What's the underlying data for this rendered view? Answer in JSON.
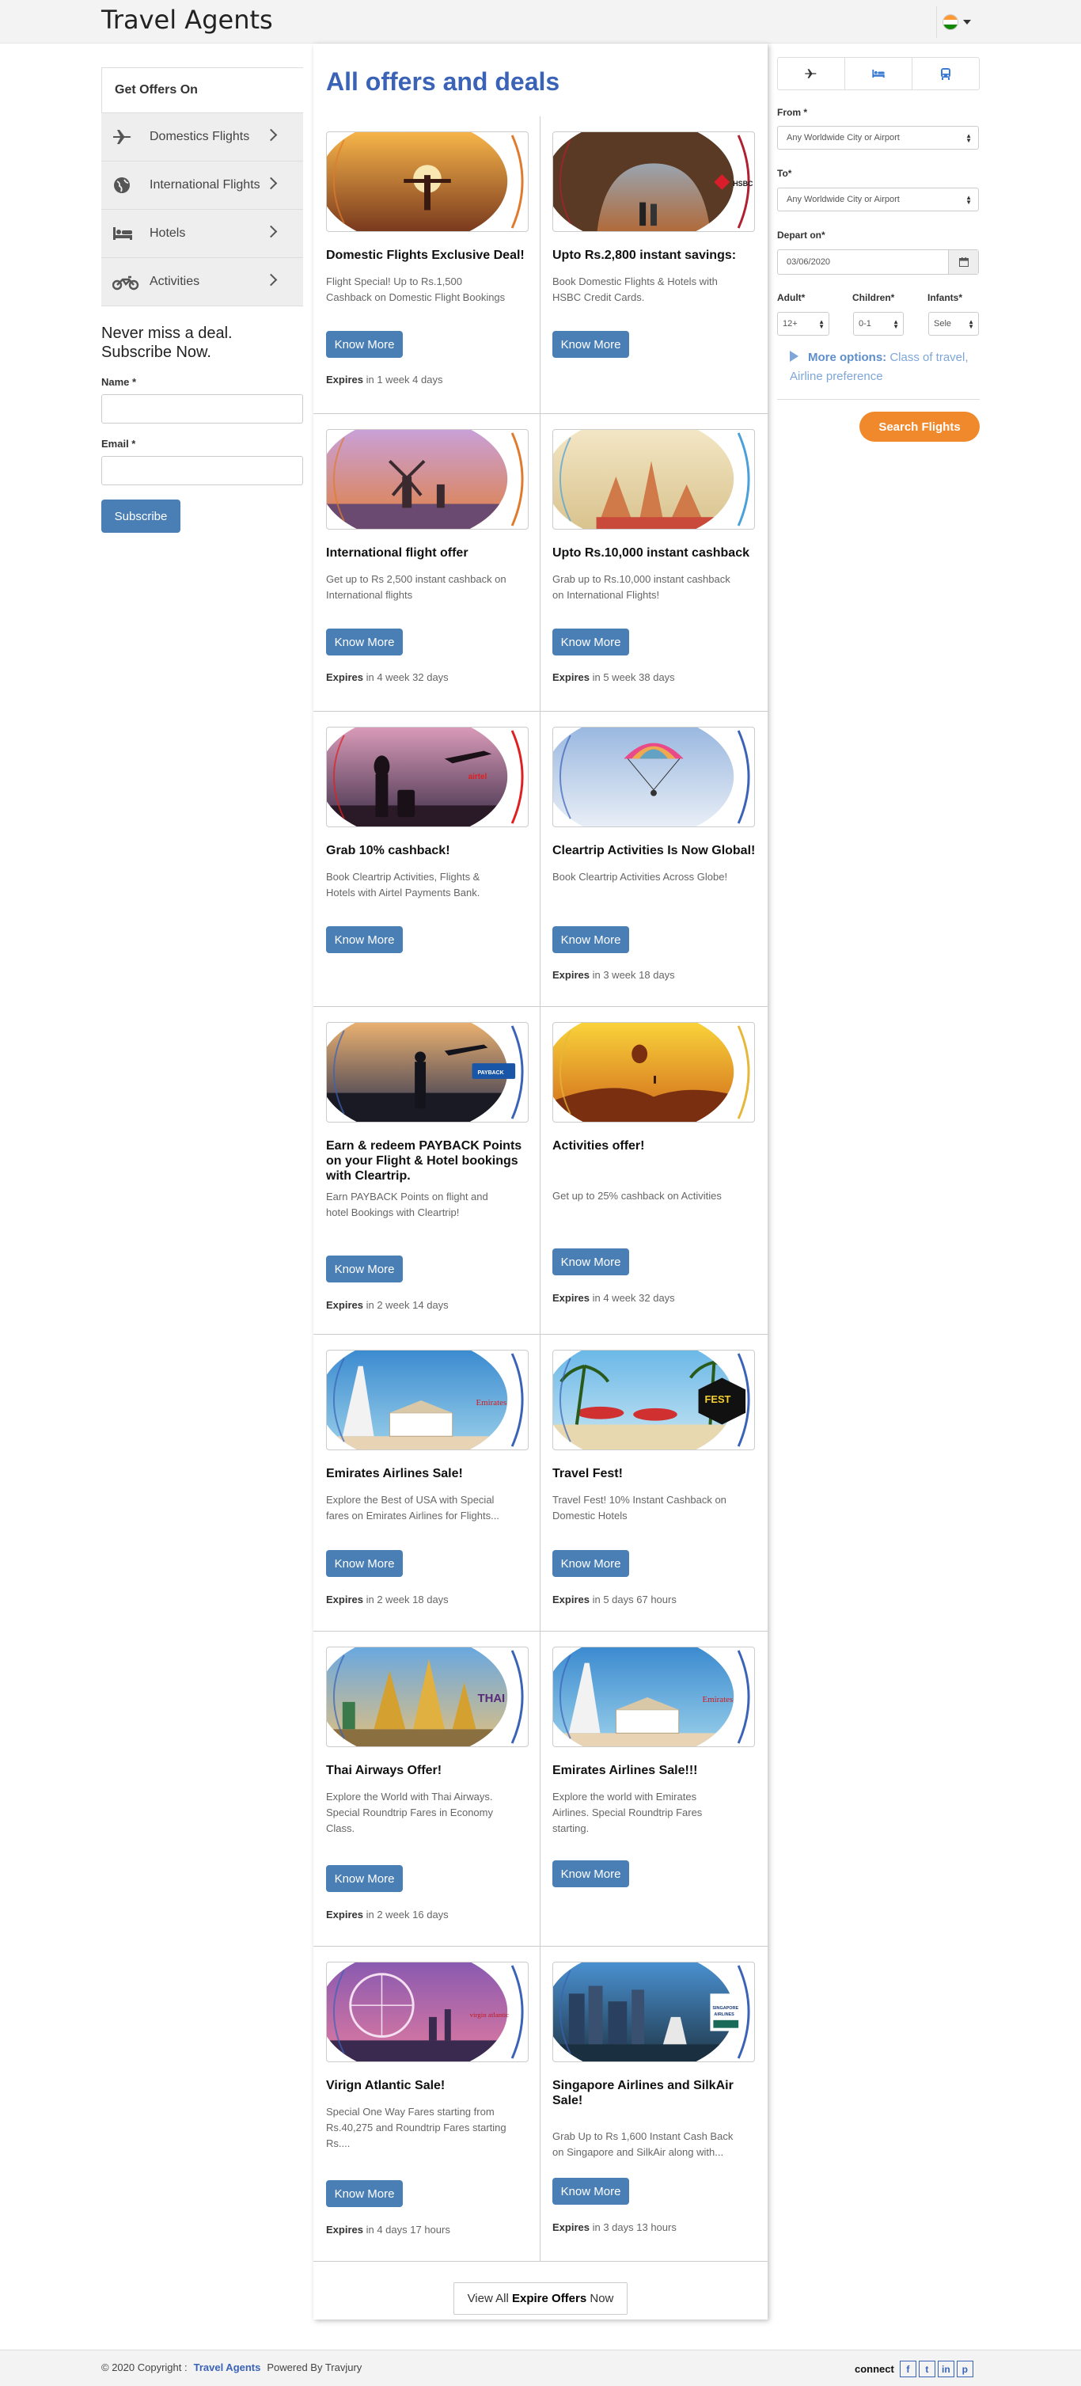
{
  "header": {
    "brand": "Travel Agents"
  },
  "sidebar": {
    "heading": "Get Offers On",
    "items": [
      {
        "label": "Domestics Flights",
        "icon": "plane-icon"
      },
      {
        "label": "International Flights",
        "icon": "globe-icon"
      },
      {
        "label": "Hotels",
        "icon": "bed-icon"
      },
      {
        "label": "Activities",
        "icon": "motorcycle-icon"
      }
    ],
    "subscribe": {
      "title": "Never miss a deal. Subscribe Now.",
      "name_label": "Name *",
      "email_label": "Email *",
      "button": "Subscribe"
    }
  },
  "main": {
    "title": "All offers and deals",
    "know_more": "Know More",
    "expires_word": "Expires",
    "offers": [
      {
        "title": "Domestic Flights Exclusive Deal!",
        "desc": "Flight Special! Up to Rs.1,500 Cashback on Domestic Flight Bookings",
        "expires": "in 1 week 4 days"
      },
      {
        "title": "Upto Rs.2,800 instant savings:",
        "desc": "Book Domestic Flights & Hotels with HSBC Credit Cards.",
        "expires": "",
        "brand": "HSBC"
      },
      {
        "title": "International flight offer",
        "desc": "Get up to Rs 2,500 instant cashback on International flights",
        "expires": "in 4 week 32 days"
      },
      {
        "title": "Upto Rs.10,000 instant cashback",
        "desc": "Grab up to Rs.10,000 instant cashback on International Flights!",
        "expires": "in 5 week 38 days"
      },
      {
        "title": "Grab 10% cashback!",
        "desc": "Book Cleartrip Activities, Flights & Hotels with Airtel Payments Bank.",
        "expires": "",
        "brand": "airtel"
      },
      {
        "title": "Cleartrip Activities Is Now Global!",
        "desc": "Book Cleartrip Activities Across Globe!",
        "expires": "in 3 week 18 days"
      },
      {
        "title": "Earn & redeem PAYBACK Points on your Flight & Hotel bookings with Cleartrip.",
        "desc": "Earn PAYBACK Points on flight and hotel Bookings with Cleartrip!",
        "expires": "in 2 week 14 days",
        "brand": "PAYBACK"
      },
      {
        "title": "Activities offer!",
        "desc": "Get up to 25% cashback on Activities",
        "expires": "in 4 week 32 days"
      },
      {
        "title": "Emirates Airlines Sale!",
        "desc": "Explore the Best of USA with Special fares on Emirates Airlines for Flights...",
        "expires": "in 2 week 18 days",
        "brand": "Emirates"
      },
      {
        "title": "Travel Fest!",
        "desc": "Travel Fest! 10% Instant Cashback on Domestic Hotels",
        "expires": "in 5 days 67 hours",
        "brand": "TRAVEL FEST"
      },
      {
        "title": "Thai Airways Offer!",
        "desc": "Explore the World with Thai Airways. Special Roundtrip Fares in Economy Class.",
        "expires": "in 2 week 16 days",
        "brand": "THAI"
      },
      {
        "title": "Emirates Airlines Sale!!!",
        "desc": "Explore the world with Emirates Airlines. Special Roundtrip Fares starting.",
        "expires": "",
        "brand": "Emirates"
      },
      {
        "title": "Virign Atlantic Sale!",
        "desc": "Special One Way Fares starting from Rs.40,275 and Roundtrip Fares starting Rs....",
        "expires": "in 4 days 17 hours",
        "brand": "virgin atlantic"
      },
      {
        "title": "Singapore Airlines and SilkAir Sale!",
        "desc": "Grab Up to Rs 1,600 Instant Cash Back on Singapore and SilkAir along with...",
        "expires": "in 3 days 13 hours",
        "brand": "SINGAPORE AIRLINES"
      }
    ],
    "view_all": {
      "pre": "View All ",
      "bold": "Expire Offers",
      "post": " Now"
    }
  },
  "search": {
    "tabs": [
      "plane-icon",
      "bed-icon",
      "bus-icon"
    ],
    "from_label": "From *",
    "from_value": "Any Worldwide City or Airport",
    "to_label": "To*",
    "to_value": "Any Worldwide City or Airport",
    "depart_label": "Depart on*",
    "depart_value": "03/06/2020",
    "adult_label": "Adult*",
    "adult_value": "12+",
    "children_label": "Children*",
    "children_value": "0-1",
    "infants_label": "Infants*",
    "infants_value": "Sele",
    "more_bold": "More options:",
    "more_rest": " Class of travel, Airline preference",
    "button": "Search Flights"
  },
  "footer": {
    "copyright": "© 2020 Copyright :",
    "link": "Travel Agents",
    "powered": "Powered By Travjury",
    "connect": "connect",
    "social": [
      "f",
      "t",
      "in",
      "p"
    ]
  },
  "colors": {
    "brand_blue": "#3a63b8",
    "button_blue": "#4a7fb5",
    "search_orange": "#f0892c"
  }
}
